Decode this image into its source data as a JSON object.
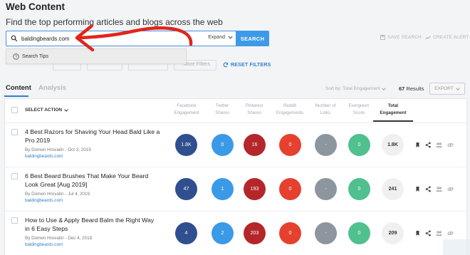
{
  "header": {
    "title": "Web Content",
    "subtitle": "Find the top performing articles and blogs across the web"
  },
  "search": {
    "value": "baldingbeards.com",
    "expand_label": "Expand",
    "button_label": "SEARCH",
    "dropdown_label": "Search Tips"
  },
  "top_actions": {
    "save_search": "SAVE SEARCH",
    "create_alert": "CREATE ALERT"
  },
  "filters": {
    "more_filters": "More Filters",
    "reset_filters": "RESET FILTERS"
  },
  "tabs": [
    {
      "label": "Content",
      "active": true
    },
    {
      "label": "Analysis",
      "active": false
    }
  ],
  "toolbar": {
    "sort_by": "Sort by: Total Engagement",
    "results_count": "67",
    "results_label": "Results",
    "export_label": "EXPORT"
  },
  "table": {
    "select_action": "SELECT ACTION",
    "columns": [
      {
        "label_1": "Facebook",
        "label_2": "Engagement"
      },
      {
        "label_1": "Twitter",
        "label_2": "Shares"
      },
      {
        "label_1": "Pinterest",
        "label_2": "Shares"
      },
      {
        "label_1": "Reddit",
        "label_2": "Engagements"
      },
      {
        "label_1": "Number of",
        "label_2": "Links"
      },
      {
        "label_1": "Evergreen",
        "label_2": "Score"
      },
      {
        "label_1": "Total",
        "label_2": "Engagement"
      }
    ],
    "rows": [
      {
        "title": "4 Best Razors for Shaving Your Head Bald Like a Pro 2019",
        "byline": "By Domen Hrovatin - Oct 3, 2019",
        "domain": "baldingbeards.com",
        "metrics": [
          "1.8K",
          "0",
          "16",
          "0",
          "-",
          "0",
          "1.8K"
        ]
      },
      {
        "title": "6 Best Beard Brushes That Make Your Beard Look Great [Aug 2019]",
        "byline": "By Domen Hrovatin - Jul 4, 2019",
        "domain": "baldingbeards.com",
        "metrics": [
          "47",
          "1",
          "193",
          "0",
          "-",
          "0",
          "241"
        ]
      },
      {
        "title": "How to Use & Apply Beard Balm the Right Way in 6 Easy Steps",
        "byline": "By Domen Hrovatin - Dec 4, 2018",
        "domain": "baldingbeards.com",
        "metrics": [
          "4",
          "2",
          "203",
          "0",
          "-",
          "0",
          "209"
        ]
      }
    ]
  },
  "colors": {
    "facebook": "#2f4f8f",
    "twitter": "#3b9ae8",
    "pinterest": "#b5262a",
    "reddit": "#e5412e",
    "links": "#8d969e",
    "evergreen": "#4fc08e",
    "accent": "#2d7fd0",
    "annotation_arrow": "#e0251b"
  }
}
